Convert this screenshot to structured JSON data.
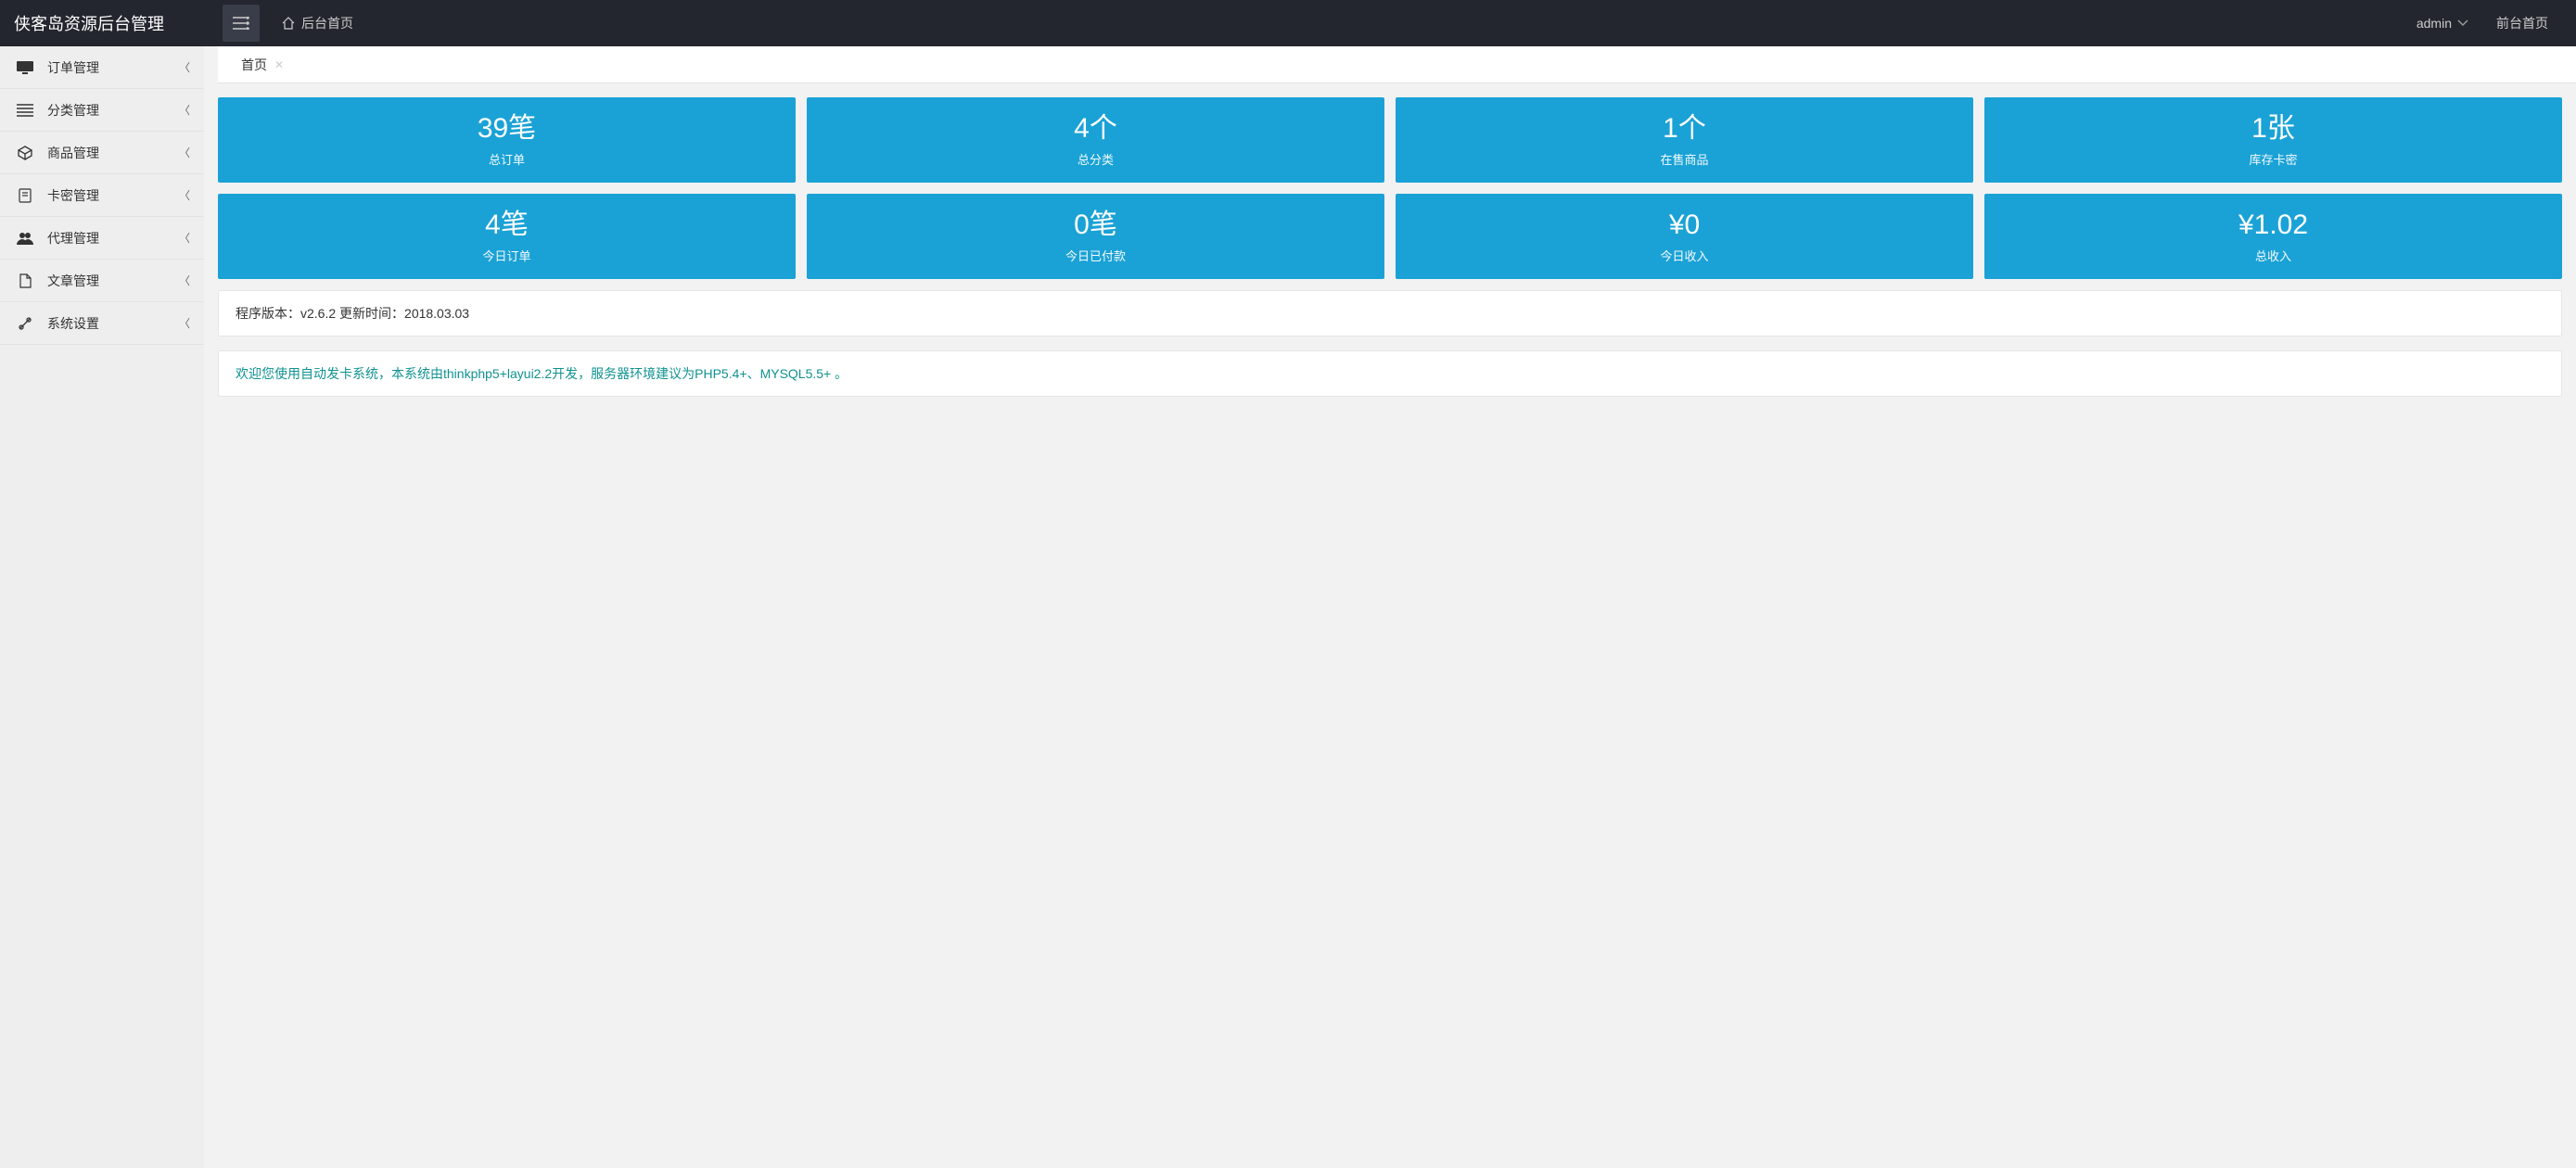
{
  "header": {
    "logo": "侠客岛资源后台管理",
    "home": "后台首页",
    "admin": "admin",
    "front": "前台首页"
  },
  "sidebar": {
    "items": [
      {
        "icon": "monitor-icon",
        "label": "订单管理"
      },
      {
        "icon": "list-icon",
        "label": "分类管理"
      },
      {
        "icon": "cube-icon",
        "label": "商品管理"
      },
      {
        "icon": "card-icon",
        "label": "卡密管理"
      },
      {
        "icon": "users-icon",
        "label": "代理管理"
      },
      {
        "icon": "file-icon",
        "label": "文章管理"
      },
      {
        "icon": "tools-icon",
        "label": "系统设置"
      }
    ]
  },
  "tabs": {
    "items": [
      {
        "label": "首页"
      }
    ]
  },
  "stats": {
    "row1": [
      {
        "value": "39笔",
        "label": "总订单"
      },
      {
        "value": "4个",
        "label": "总分类"
      },
      {
        "value": "1个",
        "label": "在售商品"
      },
      {
        "value": "1张",
        "label": "库存卡密"
      }
    ],
    "row2": [
      {
        "value": "4笔",
        "label": "今日订单"
      },
      {
        "value": "0笔",
        "label": "今日已付款"
      },
      {
        "value": "¥0",
        "label": "今日收入"
      },
      {
        "value": "¥1.02",
        "label": "总收入"
      }
    ]
  },
  "panels": {
    "version": "程序版本：v2.6.2   更新时间：2018.03.03",
    "welcome": "欢迎您使用自动发卡系统，本系统由thinkphp5+layui2.2开发，服务器环境建议为PHP5.4+、MYSQL5.5+ 。"
  }
}
